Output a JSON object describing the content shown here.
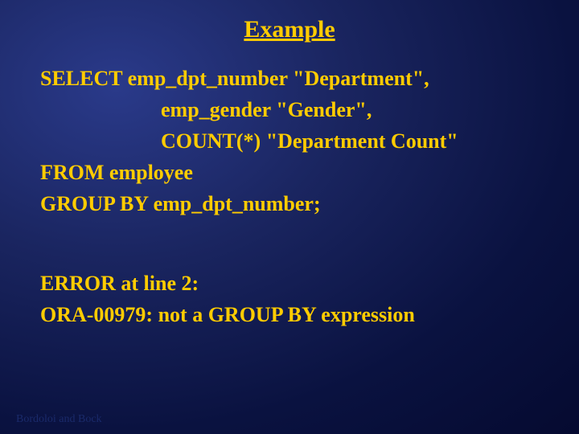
{
  "title": "Example",
  "code": {
    "line1": "SELECT  emp_dpt_number \"Department\",",
    "line2": "emp_gender \"Gender\",",
    "line3": "COUNT(*) \"Department Count\"",
    "line4": "FROM employee",
    "line5": "GROUP BY emp_dpt_number;"
  },
  "error": {
    "line1": "ERROR at line 2:",
    "line2": "ORA-00979: not a GROUP BY expression"
  },
  "footer": "Bordoloi and Bock"
}
